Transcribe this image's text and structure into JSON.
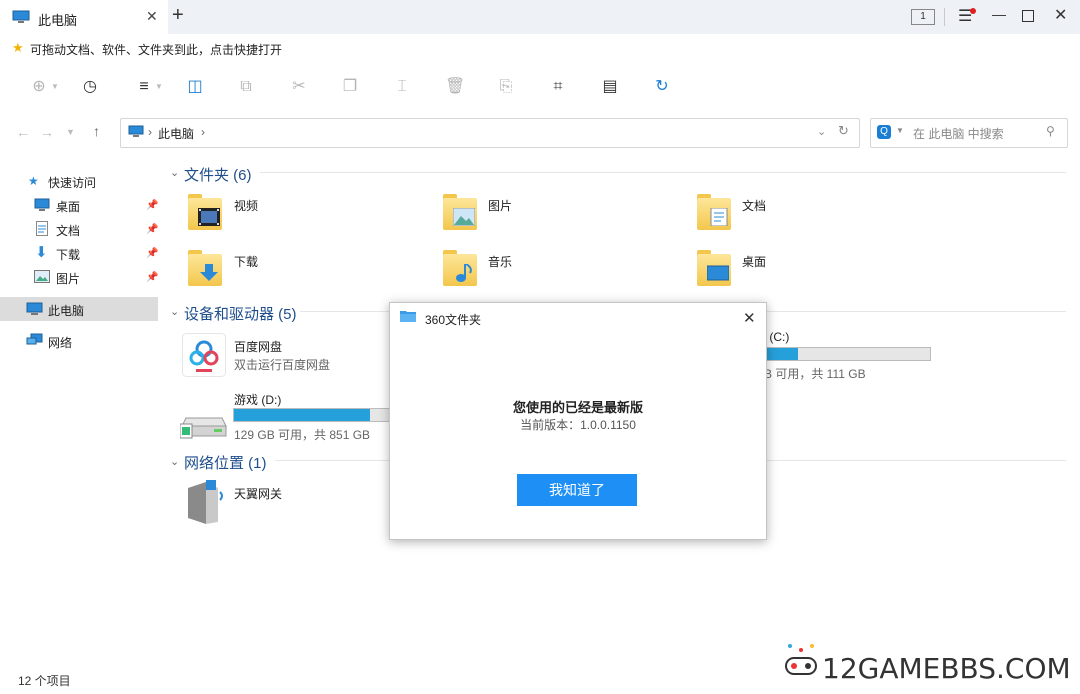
{
  "tab": {
    "title": "此电脑"
  },
  "window": {
    "badge": "1"
  },
  "favorites": {
    "hint": "可拖动文档、软件、文件夹到此，点击快捷打开"
  },
  "address": {
    "path": "此电脑",
    "separator": "›"
  },
  "search": {
    "placeholder": "在 此电脑 中搜索"
  },
  "sidebar": {
    "quick_access": "快速访问",
    "quick_items": [
      "桌面",
      "文档",
      "下载",
      "图片"
    ],
    "this_pc": "此电脑",
    "network": "网络"
  },
  "sections": {
    "folders": {
      "title": "文件夹 (6)",
      "items": [
        "视频",
        "图片",
        "文档",
        "下载",
        "音乐",
        "桌面"
      ]
    },
    "devices": {
      "title": "设备和驱动器 (5)",
      "baidu": {
        "name": "百度网盘",
        "desc": "双击运行百度网盘"
      },
      "drive_d": {
        "name": "游戏 (D:)",
        "free": "129 GB 可用，共 851 GB",
        "used_fraction": 0.85
      },
      "drive_c": {
        "name": "s (C:)",
        "free": "B 可用，共 111 GB",
        "used_fraction": 0.2
      }
    },
    "network": {
      "title": "网络位置 (1)",
      "items": [
        "天翼网关"
      ]
    }
  },
  "status": {
    "count": "12 个项目"
  },
  "modal": {
    "title": "360文件夹",
    "heading": "您使用的已经是最新版",
    "version": "当前版本：1.0.0.1150",
    "button": "我知道了"
  },
  "watermark": {
    "text": "12GAMEBBS.COM"
  },
  "colors": {
    "accent": "#1e90f5",
    "section_title": "#1e4e8c",
    "drive_fill": "#26a0da"
  }
}
